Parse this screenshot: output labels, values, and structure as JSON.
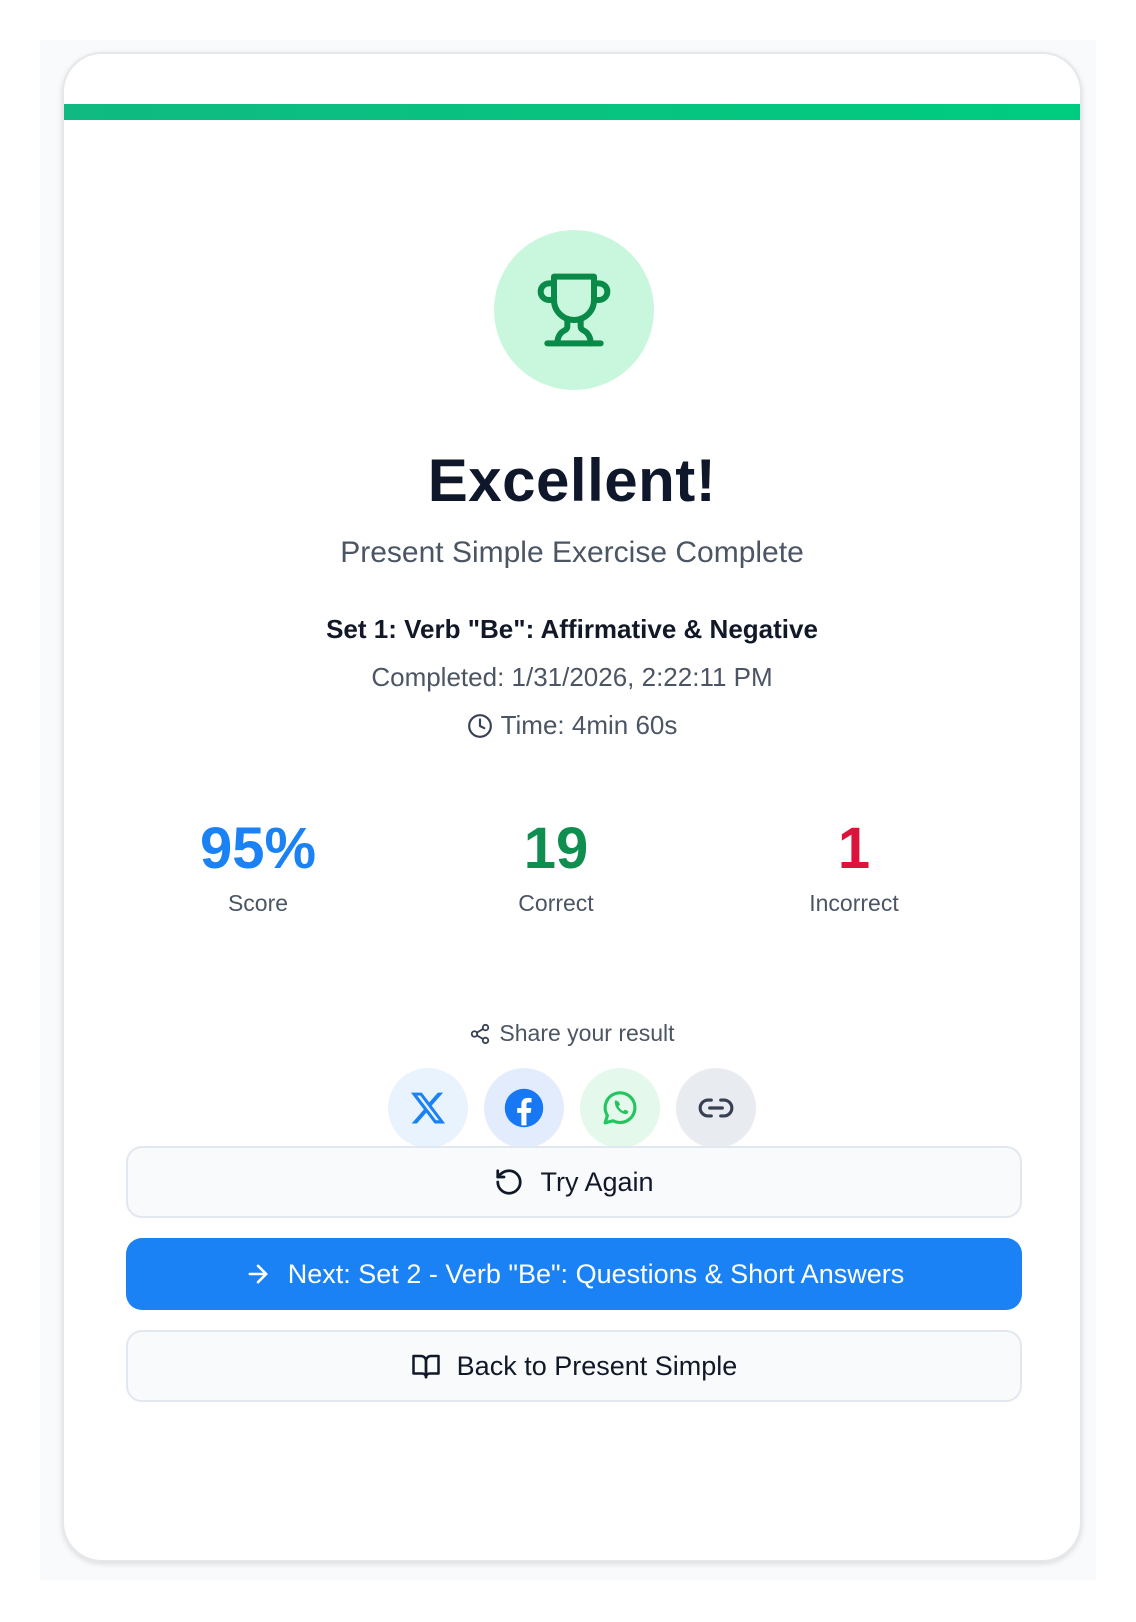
{
  "result": {
    "title": "Excellent!",
    "subtitle": "Present Simple Exercise Complete",
    "set_name": "Set 1: Verb \"Be\": Affirmative & Negative",
    "completed": "Completed: 1/31/2026, 2:22:11 PM",
    "time": "Time: 4min 60s"
  },
  "stats": {
    "score": {
      "value": "95%",
      "label": "Score"
    },
    "correct": {
      "value": "19",
      "label": "Correct"
    },
    "incorrect": {
      "value": "1",
      "label": "Incorrect"
    }
  },
  "share": {
    "label": "Share your result",
    "buttons": [
      "x-icon",
      "facebook-icon",
      "whatsapp-icon",
      "link-icon"
    ]
  },
  "actions": {
    "try_again": "Try Again",
    "next": "Next: Set 2 - Verb \"Be\": Questions & Short Answers",
    "back": "Back to Present Simple"
  },
  "colors": {
    "accent": "#10b981",
    "score": "#1a82f5",
    "correct": "#0e8f4f",
    "incorrect": "#dc143c",
    "primary_button": "#1a82f5"
  }
}
